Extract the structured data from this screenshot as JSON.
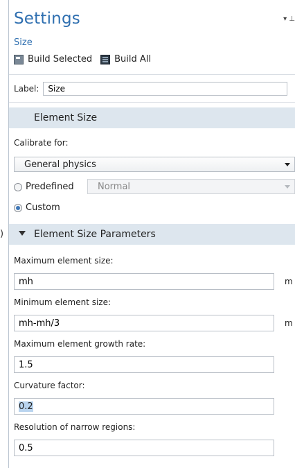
{
  "side_fragment": ")",
  "header": {
    "title": "Settings",
    "controls": "▾  ⊥",
    "subtitle": "Size"
  },
  "toolbar": {
    "build_selected": "Build Selected",
    "build_all": "Build All"
  },
  "label_field": {
    "label": "Label:",
    "value": "Size"
  },
  "element_size": {
    "header": "Element Size",
    "calibrate_label": "Calibrate for:",
    "calibrate_value": "General physics",
    "predefined_label": "Predefined",
    "predefined_value": "Normal",
    "custom_label": "Custom",
    "selected_option": "Custom"
  },
  "parameters": {
    "header": "Element Size Parameters",
    "max_size_label": "Maximum element size:",
    "max_size_value": "mh",
    "max_size_unit": "m",
    "min_size_label": "Minimum element size:",
    "min_size_value": "mh-mh/3",
    "min_size_unit": "m",
    "growth_label": "Maximum element growth rate:",
    "growth_value": "1.5",
    "curvature_label": "Curvature factor:",
    "curvature_value": "0.2",
    "narrow_label": "Resolution of narrow regions:",
    "narrow_value": "0.5"
  }
}
